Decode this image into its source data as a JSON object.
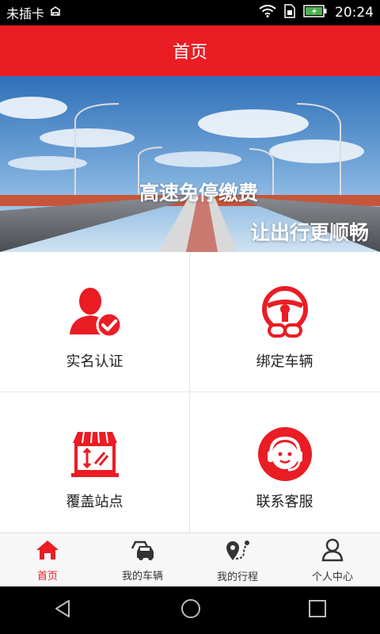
{
  "status_bar": {
    "carrier": "未插卡",
    "time": "20:24"
  },
  "header": {
    "title": "首页"
  },
  "banner": {
    "line1": "高速免停缴费",
    "line2": "让出行更顺畅"
  },
  "features": [
    {
      "label": "实名认证",
      "icon": "user-verified-icon"
    },
    {
      "label": "绑定车辆",
      "icon": "steering-wheel-link-icon"
    },
    {
      "label": "覆盖站点",
      "icon": "toll-station-icon"
    },
    {
      "label": "联系客服",
      "icon": "customer-service-icon"
    }
  ],
  "tabs": [
    {
      "label": "首页",
      "icon": "home-icon",
      "active": true
    },
    {
      "label": "我的车辆",
      "icon": "cars-icon",
      "active": false
    },
    {
      "label": "我的行程",
      "icon": "route-icon",
      "active": false
    },
    {
      "label": "个人中心",
      "icon": "person-icon",
      "active": false
    }
  ],
  "colors": {
    "primary": "#ea1c24",
    "text": "#222222",
    "tab_bg": "#f7f7f7"
  }
}
